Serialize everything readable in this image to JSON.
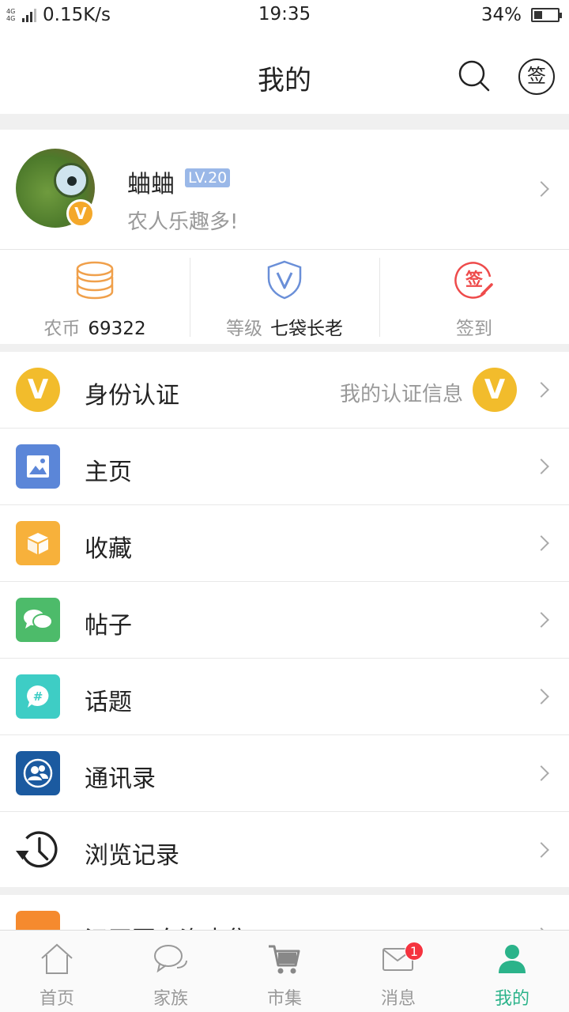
{
  "status_bar": {
    "network": "4G 4G",
    "speed": "0.15K/s",
    "time": "19:35",
    "battery_pct": "34%",
    "battery_level": 0.34
  },
  "header": {
    "title": "我的",
    "search_icon": "search-icon",
    "sign_label": "签"
  },
  "profile": {
    "username": "蛐蛐",
    "level": "LV.20",
    "motto": "农人乐趣多!",
    "badge": "V"
  },
  "stats": [
    {
      "icon": "coin-stack-icon",
      "label": "农币",
      "value": "69322",
      "color": "#f0a04b"
    },
    {
      "icon": "shield-v-icon",
      "label": "等级",
      "value": "七袋长老",
      "color": "#6a8fd8"
    },
    {
      "icon": "sign-in-icon",
      "label": "签到",
      "value": "",
      "color": "#ee4b4b"
    }
  ],
  "list": {
    "identity": {
      "label": "身份认证",
      "sub": "我的认证信息",
      "badge": "V",
      "color": "#f2bc2c"
    },
    "items": [
      {
        "label": "主页",
        "icon": "image-icon",
        "color": "#5b86d8"
      },
      {
        "label": "收藏",
        "icon": "box-icon",
        "color": "#f7b13b"
      },
      {
        "label": "帖子",
        "icon": "chat-bubbles-icon",
        "color": "#4dbb6a"
      },
      {
        "label": "话题",
        "icon": "hashtag-icon",
        "color": "#3ecdc5"
      },
      {
        "label": "通讯录",
        "icon": "contacts-icon",
        "color": "#1b5aa0"
      },
      {
        "label": "浏览记录",
        "icon": "history-clock-icon",
        "color": "#ffffff"
      }
    ],
    "partial": {
      "label": "汉田园向资声集",
      "color": "#f58a2e"
    }
  },
  "tabbar": {
    "tabs": [
      {
        "label": "首页",
        "icon": "home-icon"
      },
      {
        "label": "家族",
        "icon": "chat-icon"
      },
      {
        "label": "市集",
        "icon": "cart-icon"
      },
      {
        "label": "消息",
        "icon": "mail-icon",
        "badge": "1"
      },
      {
        "label": "我的",
        "icon": "person-icon",
        "active": true
      }
    ],
    "active_color": "#2bb38a"
  }
}
